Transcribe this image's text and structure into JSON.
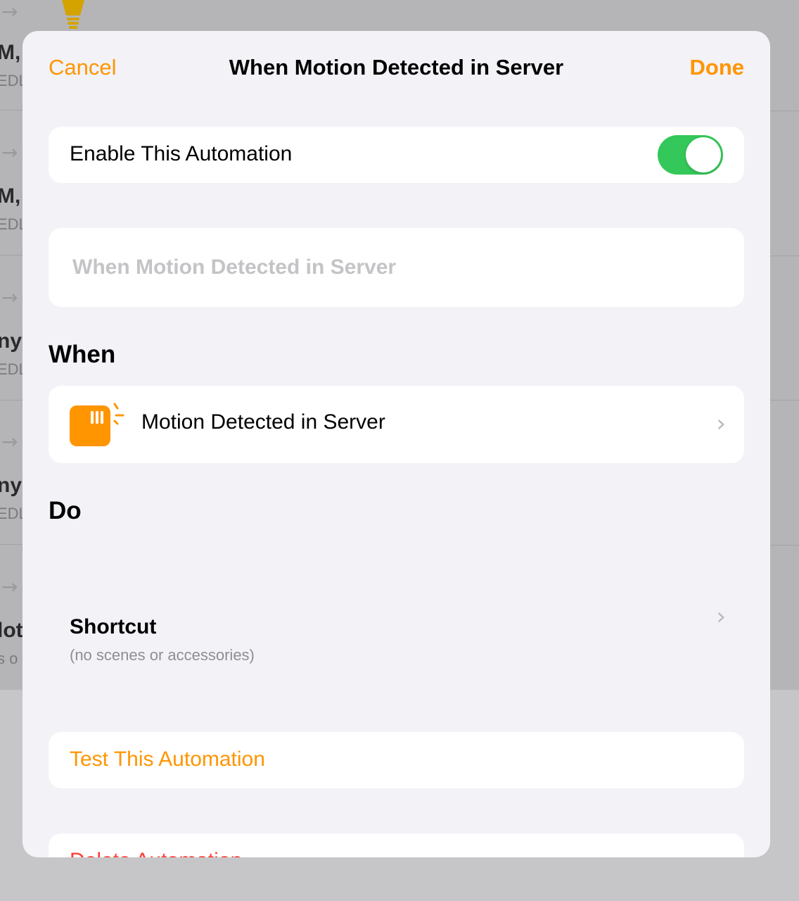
{
  "background": {
    "rows": [
      {
        "title": "M, D",
        "subtitle": "EDL"
      },
      {
        "title": "M, I",
        "subtitle": "EDL"
      },
      {
        "title": "ny",
        "subtitle": "EDL"
      },
      {
        "title": "ny",
        "subtitle": "EDL"
      },
      {
        "title": "lot",
        "subtitle": "s o"
      }
    ],
    "arrow_glyph": "→"
  },
  "nav": {
    "cancel_label": "Cancel",
    "title": "When Motion Detected in Server",
    "done_label": "Done"
  },
  "enable": {
    "label": "Enable This Automation",
    "on": true
  },
  "name_field": {
    "value": "",
    "placeholder": "When Motion Detected in Server"
  },
  "when": {
    "header": "When",
    "trigger_label": "Motion Detected in Server",
    "trigger_icon": "motion-sensor-icon"
  },
  "do": {
    "header": "Do",
    "title": "Shortcut",
    "subtitle": "(no scenes or accessories)"
  },
  "test_label": "Test This Automation",
  "delete_label": "Delete Automation",
  "colors": {
    "accent": "#ff9500",
    "toggle_on": "#34c759",
    "destructive": "#ff3b30",
    "sheet_bg": "#f2f2f7"
  },
  "chevron_glyph": "›"
}
